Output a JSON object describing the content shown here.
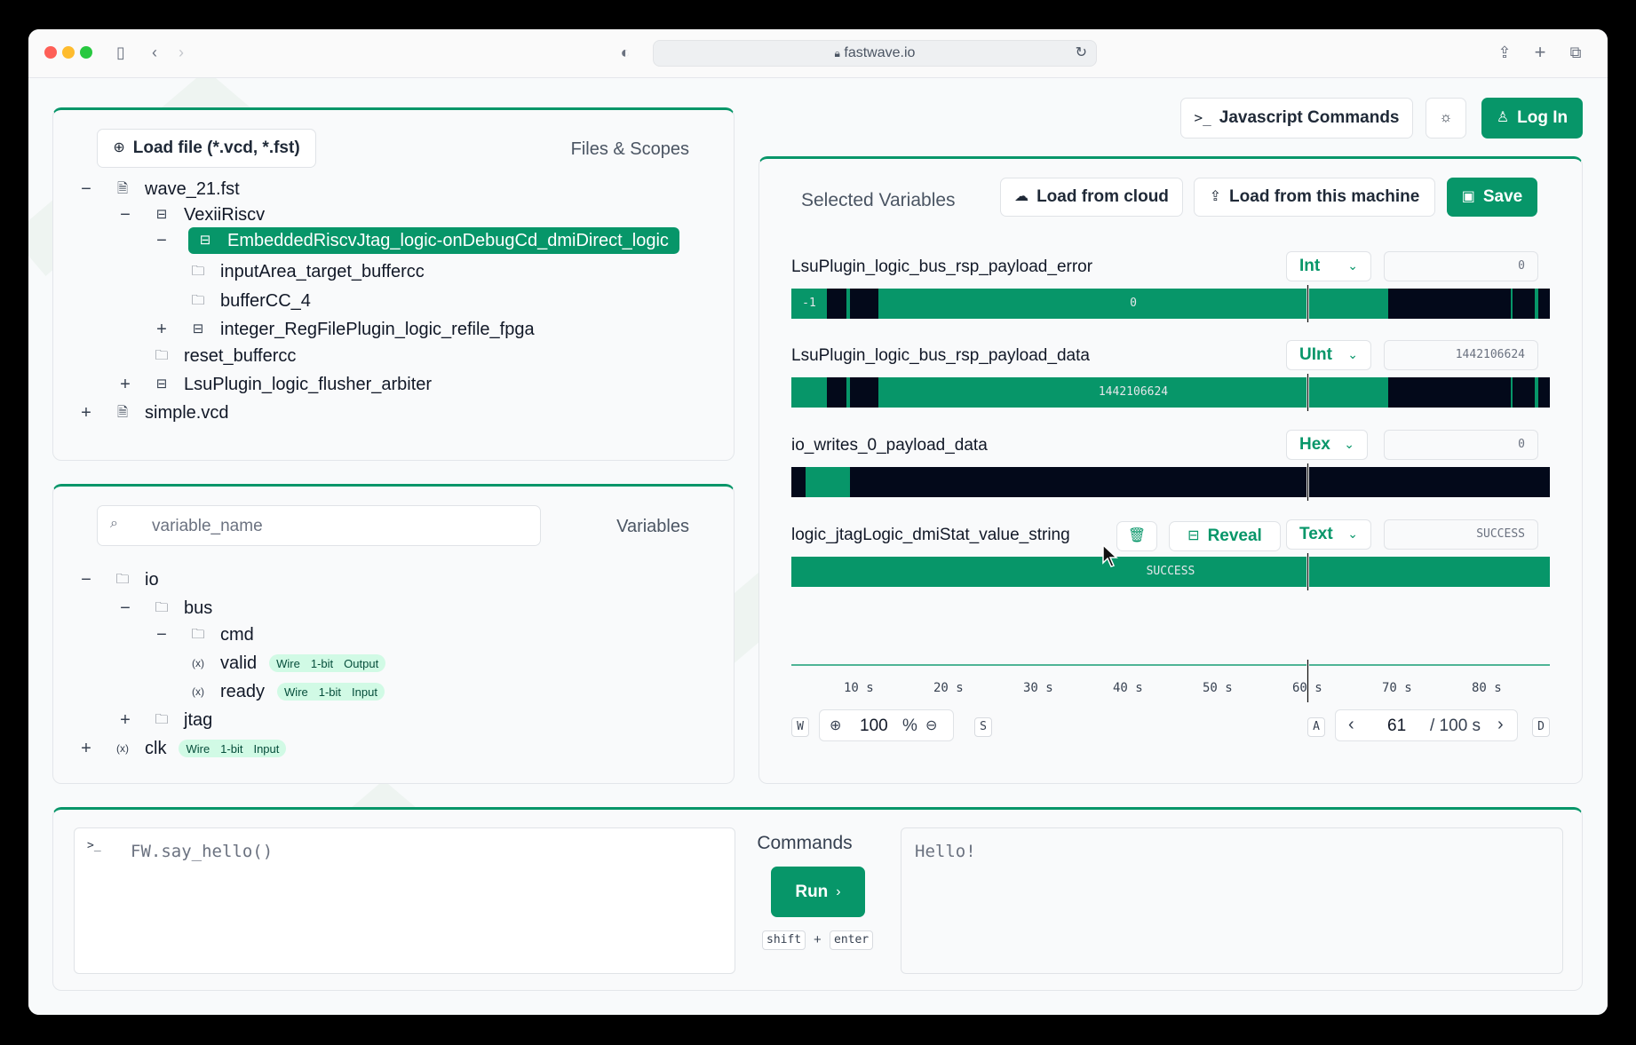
{
  "browser": {
    "url": "fastwave.io"
  },
  "colors": {
    "accent": "#079669",
    "wave_bg": "#03091a"
  },
  "header": {
    "js_commands": "Javascript Commands",
    "login": "Log In"
  },
  "files": {
    "load_button": "Load file (*.vcd, *.fst)",
    "title": "Files & Scopes",
    "tree": [
      {
        "label": "wave_21.fst",
        "toggle": "−",
        "icon": "file-icon"
      },
      {
        "label": "VexiiRiscv",
        "toggle": "−",
        "icon": "scope-icon"
      },
      {
        "label": "EmbeddedRiscvJtag_logic-onDebugCd_dmiDirect_logic",
        "toggle": "−",
        "icon": "scope-icon",
        "selected": true
      },
      {
        "label": "inputArea_target_buffercc",
        "toggle": "",
        "icon": "folder-icon"
      },
      {
        "label": "bufferCC_4",
        "toggle": "",
        "icon": "folder-icon"
      },
      {
        "label": "integer_RegFilePlugin_logic_refile_fpga",
        "toggle": "+",
        "icon": "scope-icon"
      },
      {
        "label": "reset_buffercc",
        "toggle": "",
        "icon": "folder-icon"
      },
      {
        "label": "LsuPlugin_logic_flusher_arbiter",
        "toggle": "+",
        "icon": "scope-icon"
      },
      {
        "label": "simple.vcd",
        "toggle": "+",
        "icon": "file-icon"
      }
    ]
  },
  "variables": {
    "search_placeholder": "variable_name",
    "title": "Variables",
    "tree": [
      {
        "label": "io",
        "toggle": "−",
        "icon": "folder-icon"
      },
      {
        "label": "bus",
        "toggle": "−",
        "icon": "folder-icon"
      },
      {
        "label": "cmd",
        "toggle": "−",
        "icon": "folder-icon"
      },
      {
        "label": "valid",
        "toggle": "",
        "icon": "variable-icon",
        "badges": [
          "Wire",
          "1-bit",
          "Output"
        ]
      },
      {
        "label": "ready",
        "toggle": "",
        "icon": "variable-icon",
        "badges": [
          "Wire",
          "1-bit",
          "Input"
        ]
      },
      {
        "label": "jtag",
        "toggle": "+",
        "icon": "folder-icon"
      },
      {
        "label": "clk",
        "toggle": "+",
        "icon": "variable-icon",
        "badges": [
          "Wire",
          "1-bit",
          "Input"
        ]
      }
    ]
  },
  "selected": {
    "title": "Selected Variables",
    "load_cloud": "Load from cloud",
    "load_machine": "Load from this machine",
    "save": "Save",
    "reveal": "Reveal",
    "signals": [
      {
        "name": "LsuPlugin_logic_bus_rsp_payload_error",
        "format": "Int",
        "value": "0",
        "labels": [
          "-1",
          "0"
        ]
      },
      {
        "name": "LsuPlugin_logic_bus_rsp_payload_data",
        "format": "UInt",
        "value": "1442106624",
        "labels": [
          "1442106624"
        ]
      },
      {
        "name": "io_writes_0_payload_data",
        "format": "Hex",
        "value": "0",
        "labels": []
      },
      {
        "name": "logic_jtagLogic_dmiStat_value_string",
        "format": "Text",
        "value": "SUCCESS",
        "labels": [
          "SUCCESS"
        ]
      }
    ],
    "ticks": [
      "10 s",
      "20 s",
      "30 s",
      "40 s",
      "50 s",
      "60 s",
      "70 s",
      "80 s"
    ],
    "zoom_key_in": "W",
    "zoom_key_out": "S",
    "zoom_value": "100",
    "zoom_unit": "%",
    "nav_key_prev": "A",
    "nav_key_next": "D",
    "time_value": "61",
    "time_total": "/ 100 s"
  },
  "console": {
    "input": "FW.say_hello()",
    "title": "Commands",
    "run": "Run",
    "shortcut_a": "shift",
    "shortcut_plus": "+",
    "shortcut_b": "enter",
    "output": "Hello!"
  }
}
